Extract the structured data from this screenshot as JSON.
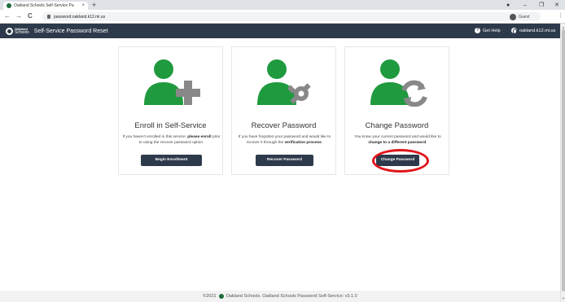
{
  "browser": {
    "tab_title": "Oakland Schools Self-Service Pa",
    "tab_close": "×",
    "new_tab": "+",
    "url": "password.oakland.k12.mi.us",
    "guest_label": "Guest",
    "back": "←",
    "forward": "→",
    "reload": "C",
    "minimize": "–",
    "maximize": "❐",
    "close": "✕",
    "menu": "⋮"
  },
  "header": {
    "logo_line1": "Oakland",
    "logo_line2": "Schools",
    "title": "Self-Service Password Reset",
    "help_label": "Get Help",
    "help_glyph": "?",
    "domain_label": "oakland.k12.mi.us"
  },
  "cards": [
    {
      "icon": "user-plus-icon",
      "title": "Enroll in Self-Service",
      "desc_pre": "If you haven't enrolled in this service, ",
      "desc_bold": "please enroll",
      "desc_post": " prior to using the recover password option.",
      "button": "Begin Enrollment"
    },
    {
      "icon": "user-wrench-icon",
      "title": "Recover Password",
      "desc_pre": "If you have forgotten your password and would like to recover it through the ",
      "desc_bold": "verification process",
      "desc_post": ".",
      "button": "Recover Password"
    },
    {
      "icon": "user-sync-icon",
      "title": "Change Password",
      "desc_pre": "You know your current password and would like to ",
      "desc_bold": "change to a different password",
      "desc_post": ".",
      "button": "Change Password"
    }
  ],
  "footer": {
    "copyright": "©2021",
    "text": "Oakland Schools. Oakland Schools Password Self-Service: v3.1.0"
  },
  "colors": {
    "header_bg": "#2d3a4b",
    "icon_green": "#1f9a3e",
    "icon_gray": "#888888",
    "highlight_red": "#e0141b"
  }
}
